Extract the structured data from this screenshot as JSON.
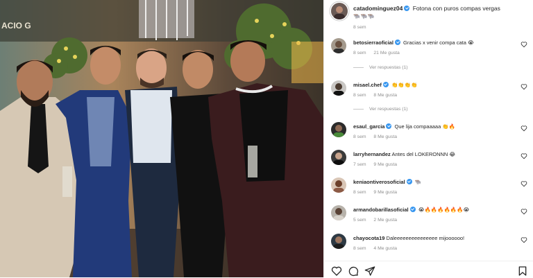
{
  "photo": {
    "sign_text": "ACIO G"
  },
  "post": {
    "username": "catadominguez04",
    "caption": "Fotona con puros compas vergas",
    "caption_emojis": "🐃🐃🐃",
    "time": "8 sem"
  },
  "comments": [
    {
      "username": "betosierraoficial",
      "verified": true,
      "text": "Gracias x venir compa cata",
      "emoji": "😭",
      "time": "8 sem",
      "likes": "21 Me gusta",
      "replies": "Ver respuestas (1)"
    },
    {
      "username": "misael.chef",
      "verified": true,
      "text": "",
      "emoji": "👏👏👏👏",
      "time": "8 sem",
      "likes": "8 Me gusta",
      "replies": "Ver respuestas (1)"
    },
    {
      "username": "esaul_garcia",
      "verified": true,
      "text": "Que lija compaaaaa",
      "emoji": "👏🔥",
      "time": "8 sem",
      "likes": "8 Me gusta",
      "replies": ""
    },
    {
      "username": "larryhernandez",
      "verified": false,
      "text": "Antes del LOKERONNN",
      "emoji": "😂",
      "time": "7 sem",
      "likes": "9 Me gusta",
      "replies": ""
    },
    {
      "username": "keniaontiverosoficial",
      "verified": true,
      "text": "",
      "emoji": "🐃",
      "time": "8 sem",
      "likes": "9 Me gusta",
      "replies": ""
    },
    {
      "username": "armandobarillasoficial",
      "verified": true,
      "text": "",
      "emoji": "😭🔥🔥🔥🔥🔥🔥😭",
      "time": "5 sem",
      "likes": "2 Me gusta",
      "replies": ""
    },
    {
      "username": "chayocota19",
      "verified": false,
      "text": "Daleeeeeeeeeeeeeee mijoooooo!",
      "emoji": "",
      "time": "8 sem",
      "likes": "4 Me gusta",
      "replies": ""
    }
  ],
  "icons": [
    "heart-icon",
    "comment-icon",
    "share-icon",
    "bookmark-icon"
  ],
  "colors": {
    "verified": "#3897f0",
    "meta": "#8e8e8e",
    "text": "#262626"
  }
}
